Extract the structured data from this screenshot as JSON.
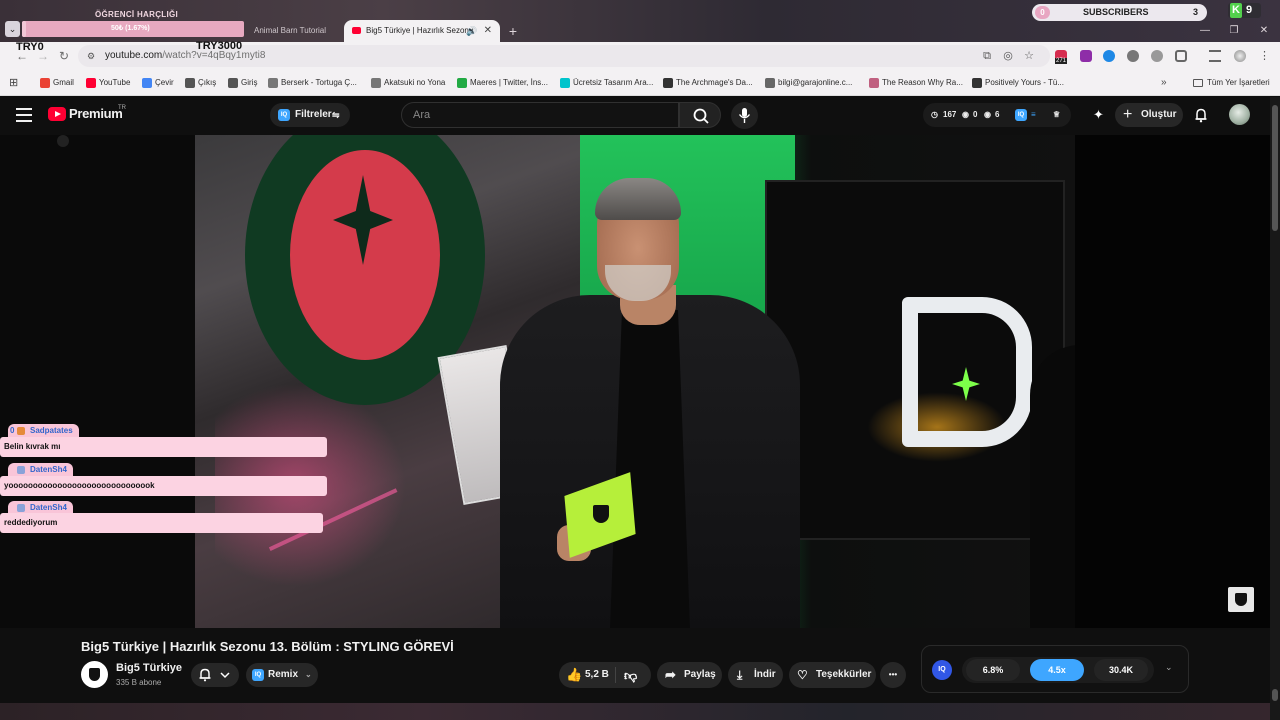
{
  "overlay": {
    "title": "ÖĞRENCİ HARÇLIĞI",
    "progress_text": "50₺ (1.67%)",
    "progress_fraction": 0.0167,
    "left_label": "TRY0",
    "right_label": "TRY3000",
    "subscribers_label": "SUBSCRIBERS",
    "subscribers_left": "0",
    "subscribers_count": "3",
    "k_badge": "K",
    "k_count": "9"
  },
  "tabs": [
    {
      "title": "Animal Barn Tutorial",
      "active": false
    },
    {
      "title": "Big5 Türkiye | Hazırlık Sezonu",
      "active": true
    }
  ],
  "tab_icons": {
    "audio": "🔊",
    "close": "✕",
    "new": "+"
  },
  "window": {
    "minimize": "—",
    "maximize": "❐",
    "close": "✕"
  },
  "address": {
    "domain": "youtube.com",
    "path": "/watch?v=4qBqy1myti8",
    "ext_badge": "271"
  },
  "bookmarks": [
    {
      "label": "Gmail",
      "color": "#ea4335"
    },
    {
      "label": "YouTube",
      "color": "#ff0033"
    },
    {
      "label": "Çevir",
      "color": "#4285f4"
    },
    {
      "label": "Çıkış",
      "color": "#555555"
    },
    {
      "label": "Giriş",
      "color": "#555555"
    },
    {
      "label": "Berserk - Tortuga Ç...",
      "color": "#777777"
    },
    {
      "label": "Akatsuki no Yona",
      "color": "#777777"
    },
    {
      "label": "Maeres | Twitter, İns...",
      "color": "#22aa44"
    },
    {
      "label": "Ücretsiz Tasarım Ara...",
      "color": "#00c4cc"
    },
    {
      "label": "The Archmage's Da...",
      "color": "#333333"
    },
    {
      "label": "bilgi@garajonline.c...",
      "color": "#666666"
    },
    {
      "label": "The Reason Why Ra...",
      "color": "#c06080"
    },
    {
      "label": "Positively Yours - Tü...",
      "color": "#333333"
    }
  ],
  "bookmarks_more": "»",
  "bookmarks_all": "Tüm Yer İşaretleri",
  "yt": {
    "brand": "Premium",
    "region": "TR",
    "filters_label": "Filtreler",
    "iq_label": "IQ",
    "search_placeholder": "Ara",
    "stats": {
      "views": "167",
      "a": "0",
      "b": "6"
    },
    "create_label": "Oluştur"
  },
  "chat": [
    {
      "user": "Sadpatates",
      "message": "Belin kıvrak mı",
      "badge_color": "#e58a3a"
    },
    {
      "user": "DatenSh4",
      "message": "yoooooooooooooooooooooooooooook",
      "badge_color": "#8aa2d8"
    },
    {
      "user": "DatenSh4",
      "message": "reddediyorum",
      "badge_color": "#8aa2d8"
    }
  ],
  "chat_badge": "0",
  "video": {
    "title": "Big5 Türkiye | Hazırlık Sezonu 13. Bölüm : STYLING GÖREVİ",
    "channel": "Big5 Türkiye",
    "subscribers": "335 B abone"
  },
  "actions": {
    "remix": "Remix",
    "likes": "5,2 B",
    "share": "Paylaş",
    "download": "İndir",
    "thanks": "Teşekkürler",
    "more": "•••"
  },
  "iq_panel": {
    "icon": "IQ",
    "values": [
      "6.8%",
      "4.5x",
      "30.4K"
    ],
    "selected_index": 1,
    "accent": "#3ea6ff"
  }
}
